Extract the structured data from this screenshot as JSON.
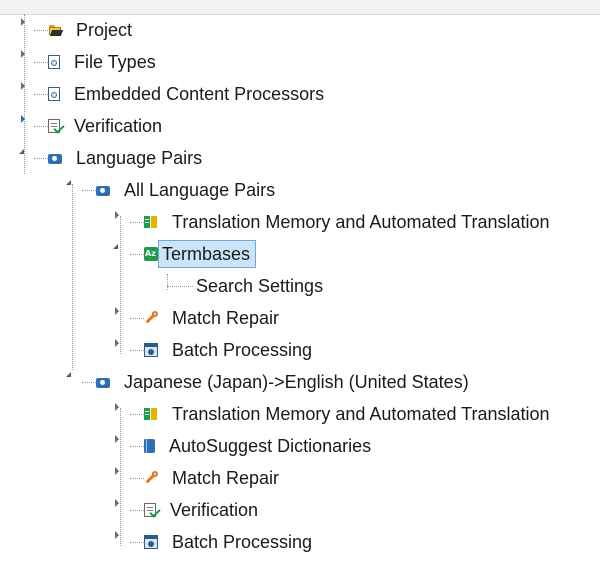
{
  "tree": {
    "project": "Project",
    "file_types": "File Types",
    "embedded": "Embedded Content Processors",
    "verification": "Verification",
    "language_pairs": "Language Pairs",
    "all_pairs": {
      "label": "All Language Pairs",
      "tm": "Translation Memory and Automated Translation",
      "termbases": "Termbases",
      "search_settings": "Search Settings",
      "match_repair": "Match Repair",
      "batch": "Batch Processing"
    },
    "ja_en": {
      "label": "Japanese (Japan)->English (United States)",
      "tm": "Translation Memory and Automated Translation",
      "autosuggest": "AutoSuggest Dictionaries",
      "match_repair": "Match Repair",
      "verification": "Verification",
      "batch": "Batch Processing"
    }
  },
  "selected_item": "Termbases",
  "colors": {
    "selection": "#cce4f7",
    "selection_border": "#6ea7d8",
    "accent": "#1e6fc2"
  },
  "icons": [
    "folder-icon",
    "document-settings-icon",
    "verification-icon",
    "language-pair-icon",
    "translation-memory-icon",
    "termbase-icon",
    "wrench-icon",
    "batch-processing-icon",
    "dictionary-icon"
  ]
}
